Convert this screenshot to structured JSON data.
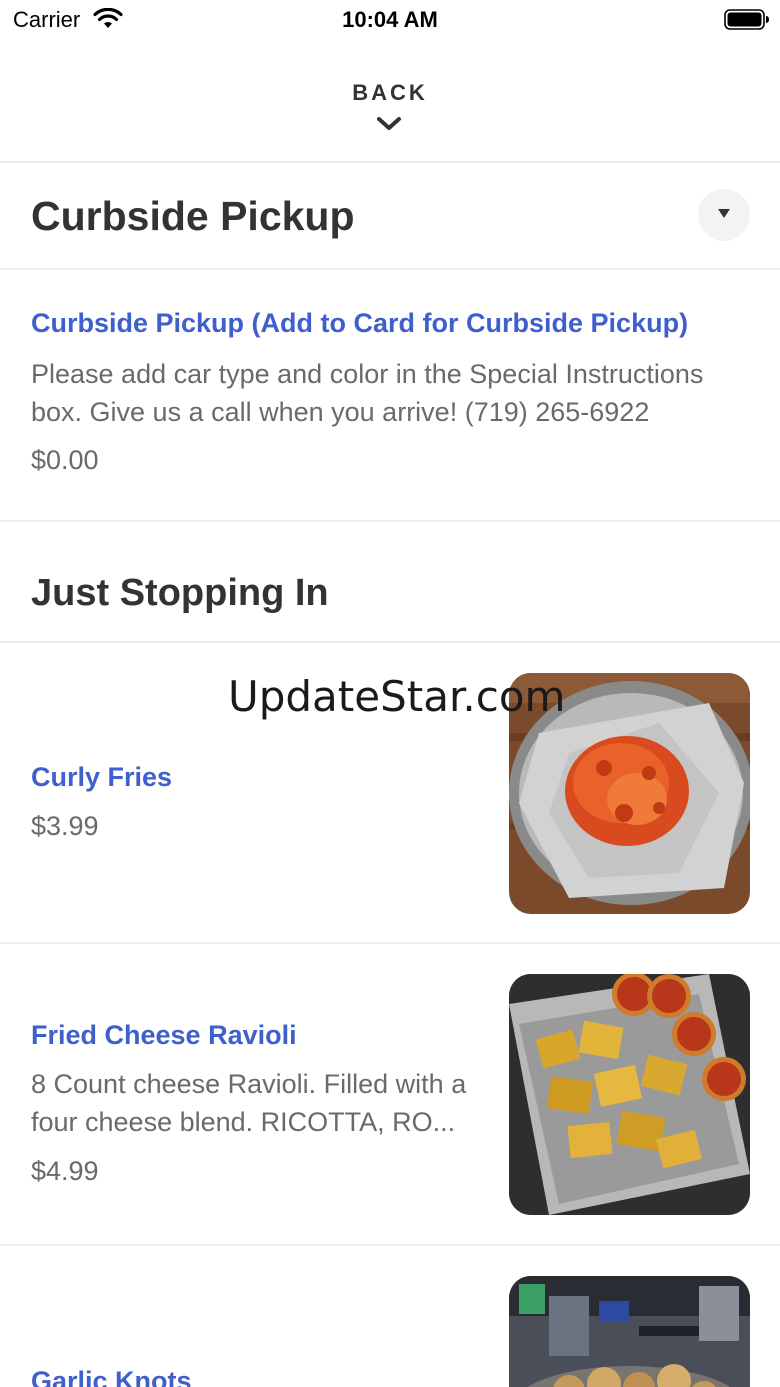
{
  "status_bar": {
    "carrier": "Carrier",
    "time": "10:04 AM"
  },
  "nav": {
    "back_label": "BACK"
  },
  "sections": [
    {
      "title": "Curbside Pickup",
      "items": [
        {
          "name": "Curbside Pickup (Add to Card for Curbside Pickup)",
          "description": "Please add car type and color in the Special Instructions box. Give us a call when you arrive! (719) 265-6922",
          "price": "$0.00"
        }
      ]
    },
    {
      "title": "Just Stopping In",
      "items": [
        {
          "name": "Curly Fries",
          "price": "$3.99",
          "image": "curly-fries-photo"
        },
        {
          "name": "Fried Cheese Ravioli",
          "description": "8 Count cheese Ravioli. Filled with a four cheese  blend. RICOTTA, RO...",
          "price": "$4.99",
          "image": "fried-cheese-ravioli-photo"
        },
        {
          "name": "Garlic Knots",
          "image": "garlic-knots-photo"
        }
      ]
    }
  ],
  "watermark": "UpdateStar.com"
}
